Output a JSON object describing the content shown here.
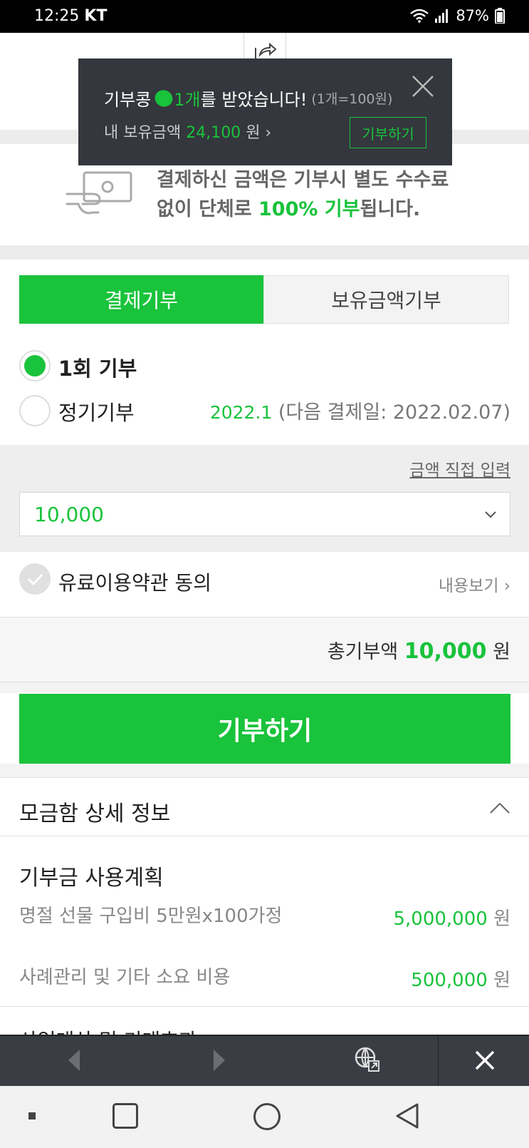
{
  "status_bar": {
    "time": "12:25",
    "carrier": "KT",
    "battery": "87%"
  },
  "toast": {
    "line1_prefix": "기부콩",
    "line1_count": "1개",
    "line1_suffix": "를 받았습니다!",
    "line1_note": "(1개=100원)",
    "line2_label": "내 보유금액",
    "line2_amount": "24,100",
    "line2_unit": "원 ›",
    "button": "기부하기"
  },
  "notice": {
    "line1": "결제하신 금액은 기부시 별도 수수료",
    "line2_prefix": "없이 단체로 ",
    "line2_highlight": "100% 기부",
    "line2_suffix": "됩니다."
  },
  "tabs": {
    "active": "결제기부",
    "inactive": "보유금액기부"
  },
  "radio": {
    "once": "1회 기부",
    "regular": "정기기부",
    "next_pay_month": "2022.1",
    "next_pay_text": " (다음 결제일: 2022.02.07)"
  },
  "amount": {
    "direct_input": "금액 직접 입력",
    "value": "10,000"
  },
  "terms": {
    "label": "유료이용약관 동의",
    "view": "내용보기 ›"
  },
  "total": {
    "label": "총기부액 ",
    "amount": "10,000",
    "unit": " 원"
  },
  "donate_button": "기부하기",
  "details": {
    "title": "모금함 상세 정보",
    "plan_title": "기부금 사용계획",
    "items": [
      {
        "name": "명절 선물 구입비 5만원x100가정",
        "amount": "5,000,000",
        "unit": " 원"
      },
      {
        "name": "사례관리 및 기타 소요 비용",
        "amount": "500,000",
        "unit": " 원"
      }
    ],
    "next_heading_cut": "사업대상 및 기대효과"
  },
  "colors": {
    "accent": "#19c33b",
    "toast_bg": "#34373d",
    "browser_bar": "#3a3d43"
  }
}
